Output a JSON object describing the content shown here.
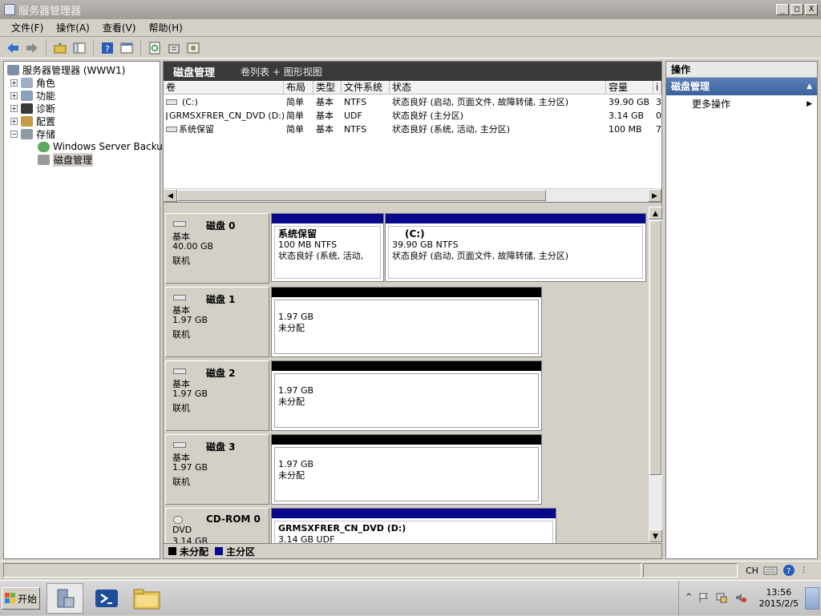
{
  "window": {
    "title": "服务器管理器",
    "min": "_",
    "max": "□",
    "close": "X"
  },
  "menu": [
    "文件(F)",
    "操作(A)",
    "查看(V)",
    "帮助(H)"
  ],
  "tree": {
    "root": "服务器管理器 (WWW1)",
    "items": [
      "角色",
      "功能",
      "诊断",
      "配置",
      "存储"
    ],
    "storage_children": [
      "Windows Server Backup",
      "磁盘管理"
    ]
  },
  "center": {
    "title": "磁盘管理",
    "subtitle": "卷列表 + 图形视图",
    "columns": [
      "卷",
      "布局",
      "类型",
      "文件系统",
      "状态",
      "容量",
      "i"
    ],
    "volumes": [
      {
        "vol": "(C:)",
        "layout": "简单",
        "type": "基本",
        "fs": "NTFS",
        "status": "状态良好 (启动, 页面文件, 故障转储, 主分区)",
        "cap": "39.90 GB",
        "extra": "3"
      },
      {
        "vol": "GRMSXFRER_CN_DVD (D:)",
        "layout": "简单",
        "type": "基本",
        "fs": "UDF",
        "status": "状态良好 (主分区)",
        "cap": "3.14 GB",
        "extra": "0"
      },
      {
        "vol": "系统保留",
        "layout": "简单",
        "type": "基本",
        "fs": "NTFS",
        "status": "状态良好 (系统, 活动, 主分区)",
        "cap": "100 MB",
        "extra": "7"
      }
    ],
    "disks": [
      {
        "name": "磁盘 0",
        "type": "基本",
        "size": "40.00 GB",
        "state": "联机"
      },
      {
        "name": "磁盘 1",
        "type": "基本",
        "size": "1.97 GB",
        "state": "联机"
      },
      {
        "name": "磁盘 2",
        "type": "基本",
        "size": "1.97 GB",
        "state": "联机"
      },
      {
        "name": "磁盘 3",
        "type": "基本",
        "size": "1.97 GB",
        "state": "联机"
      },
      {
        "name": "CD-ROM 0",
        "type": "DVD",
        "size": "3.14 GB",
        "state": ""
      }
    ],
    "parts": {
      "sys": {
        "title": "系统保留",
        "l1": "100 MB NTFS",
        "l2": "状态良好 (系统, 活动,"
      },
      "c": {
        "title": "(C:)",
        "l1": "39.90 GB NTFS",
        "l2": "状态良好 (启动, 页面文件, 故障转储, 主分区)"
      },
      "u1": {
        "l1": "1.97 GB",
        "l2": "未分配"
      },
      "u2": {
        "l1": "1.97 GB",
        "l2": "未分配"
      },
      "u3": {
        "l1": "1.97 GB",
        "l2": "未分配"
      },
      "dvd": {
        "title": "GRMSXFRER_CN_DVD  (D:)",
        "l1": "3.14 GB UDF"
      }
    },
    "legend": {
      "unalloc": "未分配",
      "primary": "主分区"
    }
  },
  "actions": {
    "header": "操作",
    "section": "磁盘管理",
    "more": "更多操作"
  },
  "taskbar": {
    "start": "开始",
    "time": "13:56",
    "date": "2015/2/5",
    "lang": "CH"
  },
  "colors": {
    "primary": "#08088a",
    "unallocated": "#000000",
    "header": "#3a3a3a"
  }
}
